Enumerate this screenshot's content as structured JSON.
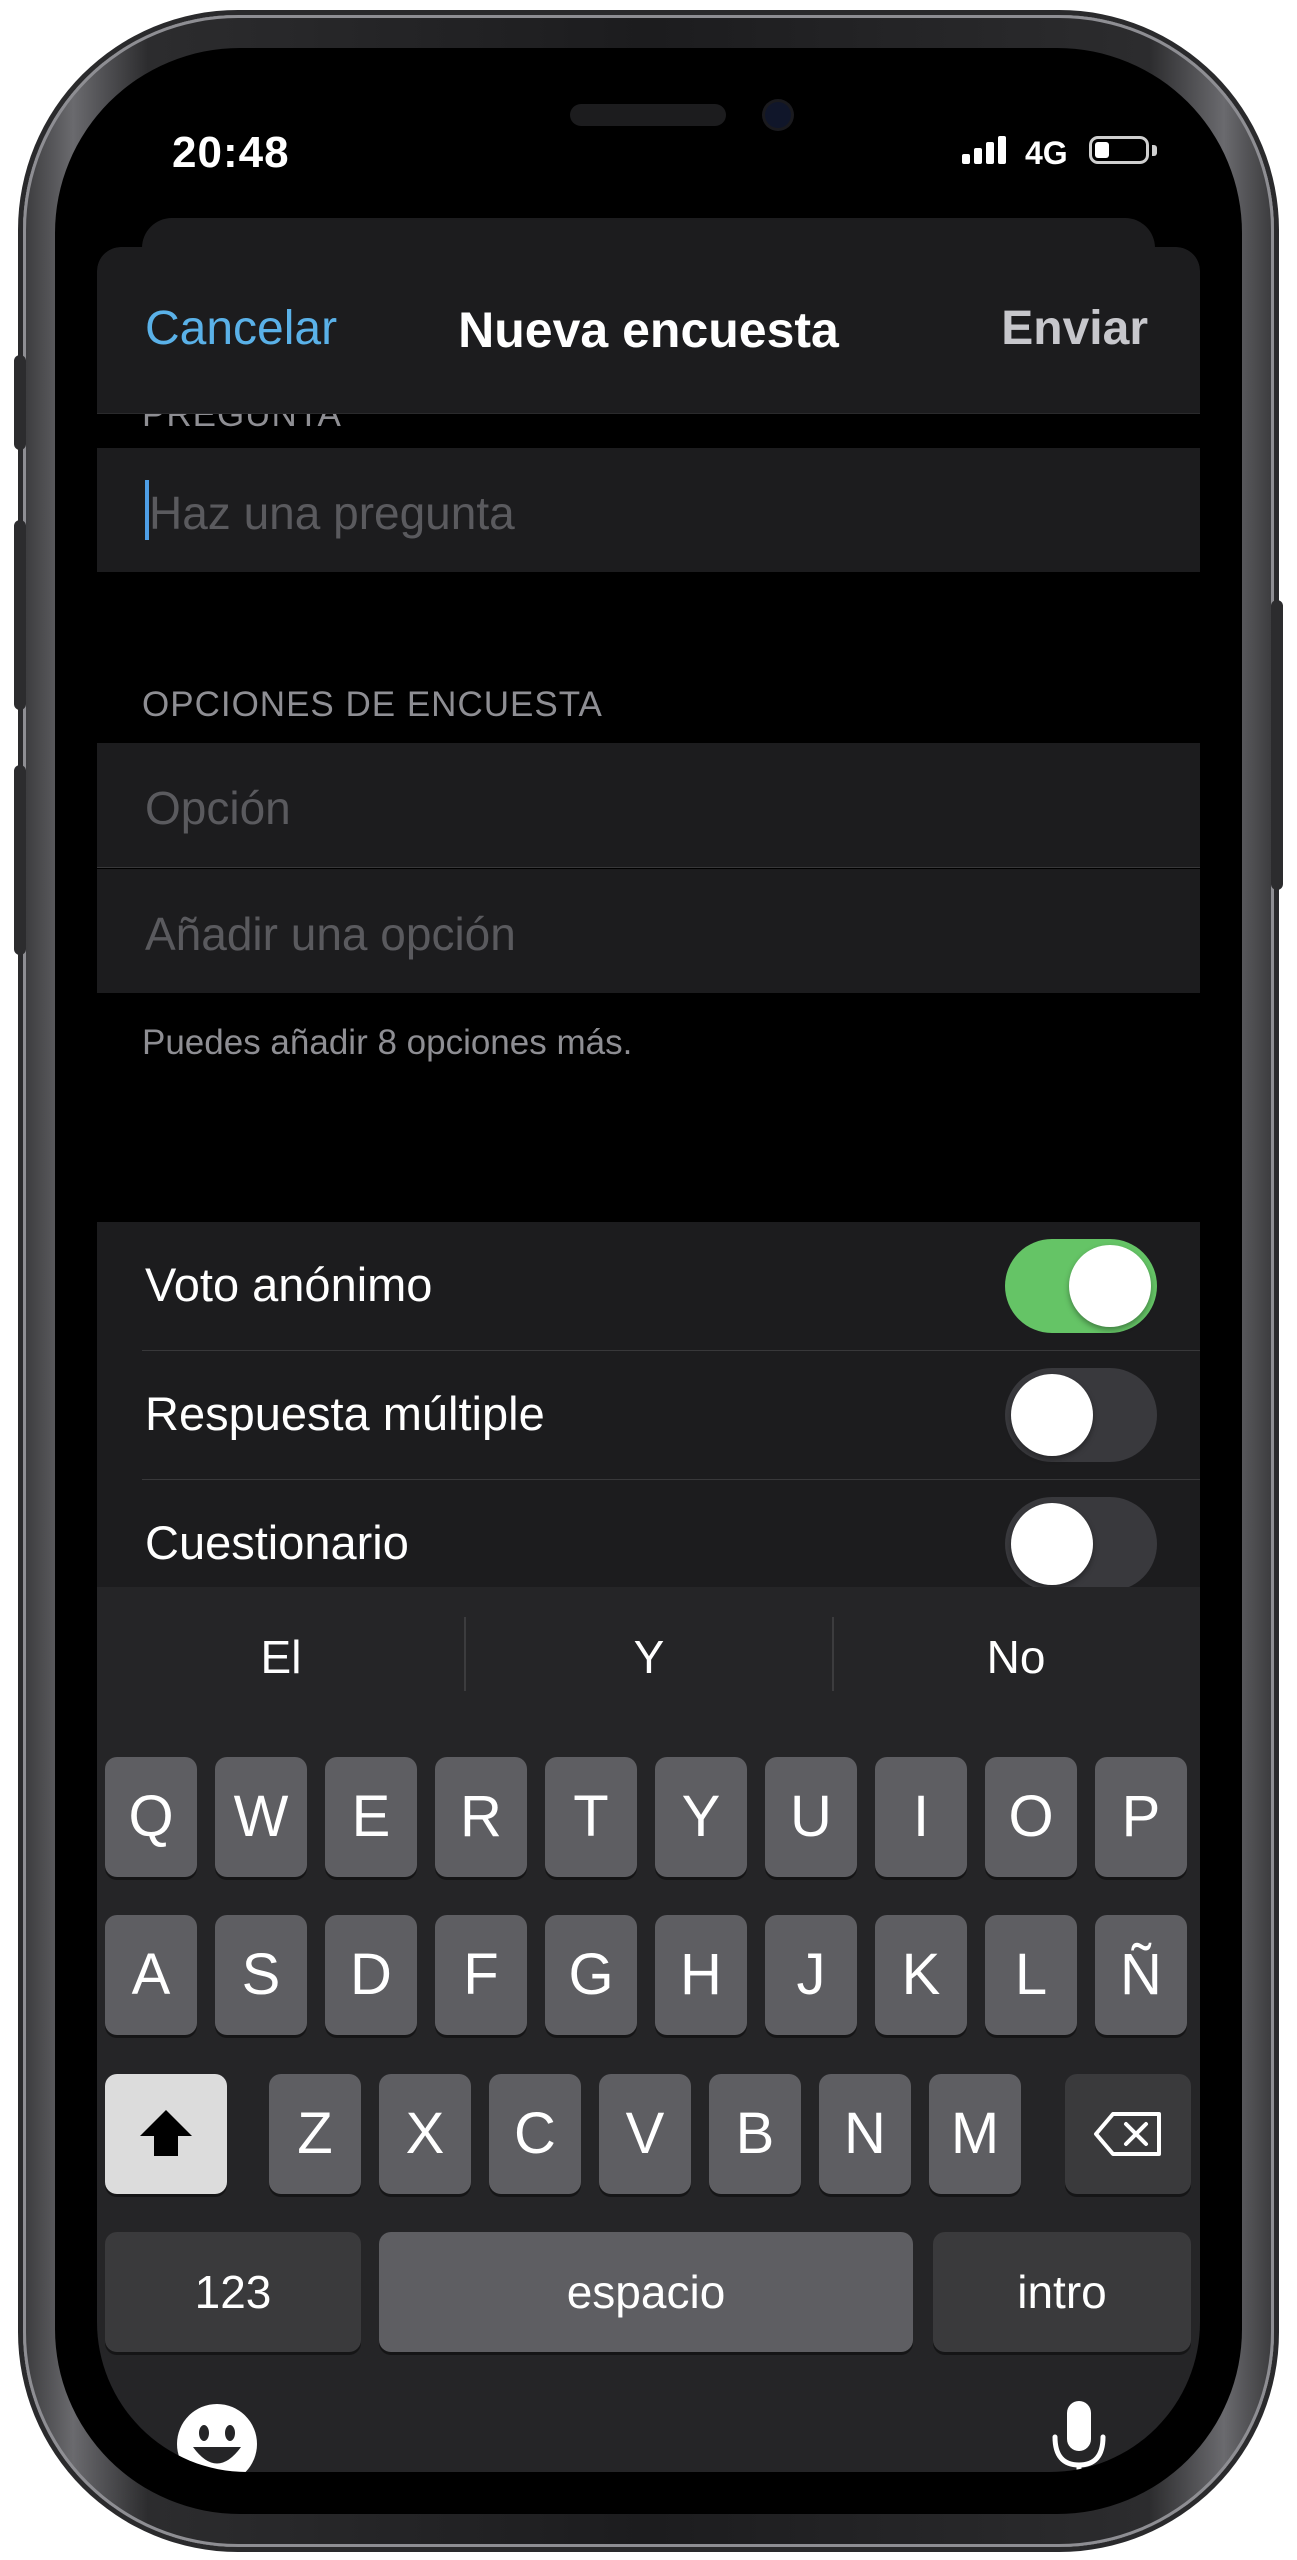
{
  "status_bar": {
    "time": "20:48",
    "network": "4G"
  },
  "nav": {
    "cancel_label": "Cancelar",
    "title": "Nueva encuesta",
    "send_label": "Enviar"
  },
  "question": {
    "section_label": "PREGUNTA",
    "placeholder": "Haz una pregunta"
  },
  "options": {
    "section_label": "OPCIONES DE ENCUESTA",
    "option_placeholder": "Opción",
    "add_option_placeholder": "Añadir una opción",
    "hint": "Puedes añadir 8 opciones más."
  },
  "toggles": [
    {
      "label": "Voto anónimo",
      "on": true
    },
    {
      "label": "Respuesta múltiple",
      "on": false
    },
    {
      "label": "Cuestionario",
      "on": false
    }
  ],
  "keyboard": {
    "suggestions": [
      "El",
      "Y",
      "No"
    ],
    "row1": [
      "Q",
      "W",
      "E",
      "R",
      "T",
      "Y",
      "U",
      "I",
      "O",
      "P"
    ],
    "row2": [
      "A",
      "S",
      "D",
      "F",
      "G",
      "H",
      "J",
      "K",
      "L",
      "Ñ"
    ],
    "row3": [
      "Z",
      "X",
      "C",
      "V",
      "B",
      "N",
      "M"
    ],
    "numbers_label": "123",
    "space_label": "espacio",
    "return_label": "intro",
    "shift_icon": "shift-icon",
    "delete_icon": "delete-icon",
    "emoji_icon": "emoji-icon",
    "mic_icon": "microphone-icon"
  },
  "colors": {
    "accent": "#5ab1e8",
    "toggle_on": "#65c466"
  }
}
